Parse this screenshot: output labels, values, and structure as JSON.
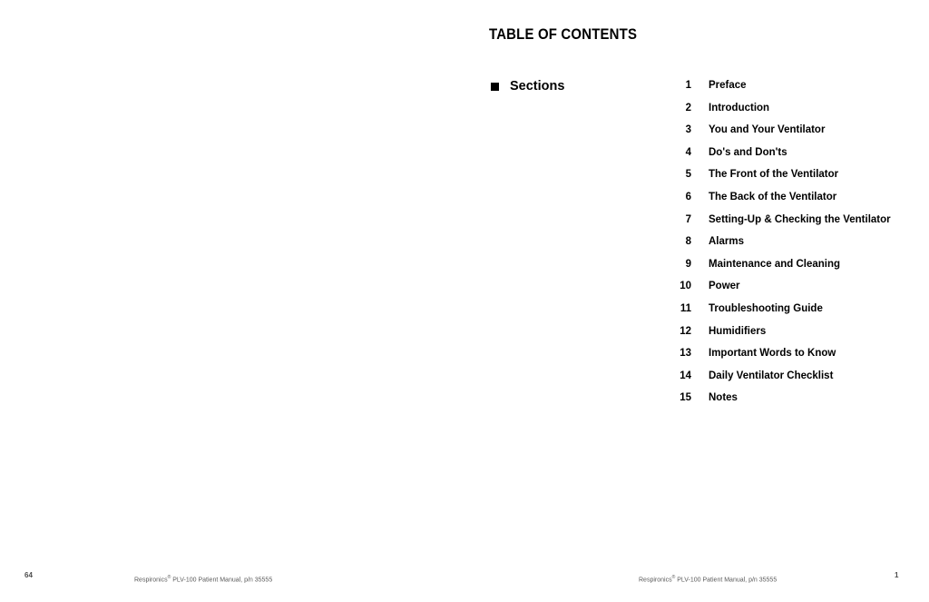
{
  "document": {
    "page_title": "TABLE OF CONTENTS",
    "section_group": {
      "bullet_icon": "filled-square-bullet",
      "label": "Sections"
    },
    "entries": [
      {
        "number": "1",
        "title": "Preface"
      },
      {
        "number": "2",
        "title": "Introduction"
      },
      {
        "number": "3",
        "title": "You and Your Ventilator"
      },
      {
        "number": "4",
        "title": "Do's and Don'ts"
      },
      {
        "number": "5",
        "title": "The Front of the Ventilator"
      },
      {
        "number": "6",
        "title": "The Back of the Ventilator"
      },
      {
        "number": "7",
        "title": "Setting-Up & Checking the Ventilator"
      },
      {
        "number": "8",
        "title": "Alarms"
      },
      {
        "number": "9",
        "title": "Maintenance and Cleaning"
      },
      {
        "number": "10",
        "title": "Power"
      },
      {
        "number": "11",
        "title": "Troubleshooting Guide"
      },
      {
        "number": "12",
        "title": "Humidifiers"
      },
      {
        "number": "13",
        "title": "Important Words to Know"
      },
      {
        "number": "14",
        "title": "Daily Ventilator Checklist"
      },
      {
        "number": "15",
        "title": "Notes"
      }
    ]
  },
  "footer": {
    "left_page_number": "64",
    "left_credit_prefix": "Respironics",
    "left_credit_suffix": " PLV-100 Patient Manual, p/n 35555",
    "right_credit_prefix": "Respironics",
    "right_credit_suffix": " PLV-100 Patient Manual, p/n 35555",
    "right_page_number": "1",
    "registered_mark": "®"
  },
  "colors": {
    "text": "#000000",
    "footer_text": "#5a5a5a",
    "page_background": "#ffffff"
  }
}
